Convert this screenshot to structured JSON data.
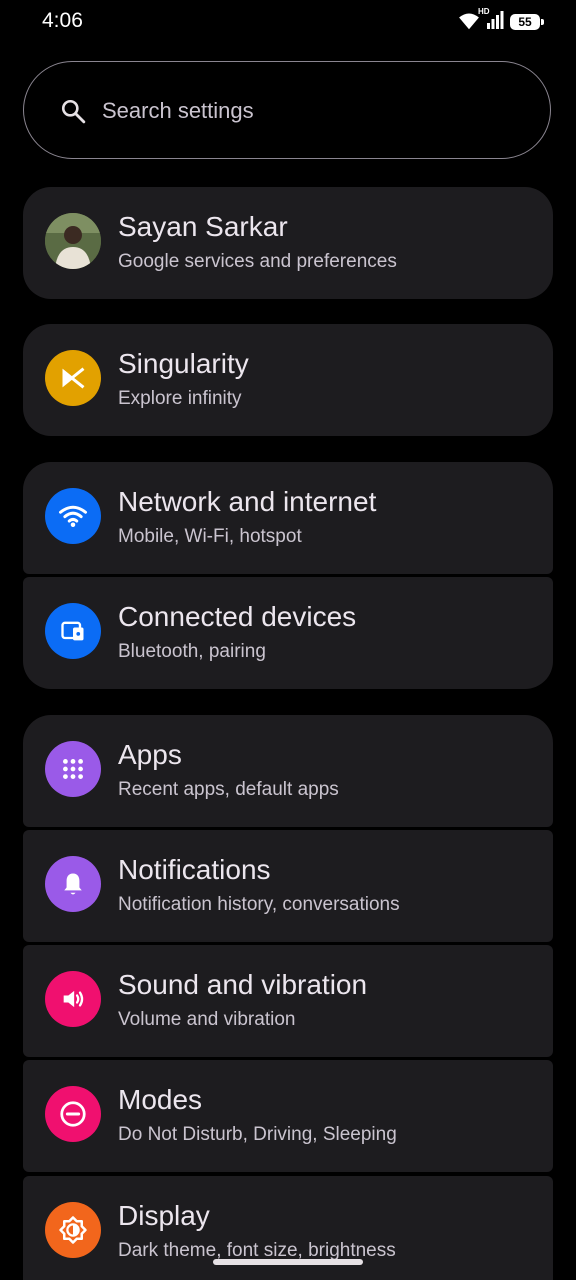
{
  "status_bar": {
    "time": "4:06",
    "network_label": "HD",
    "battery": "55"
  },
  "search": {
    "placeholder": "Search settings"
  },
  "account": {
    "name": "Sayan Sarkar",
    "subtitle": "Google services and preferences"
  },
  "items": [
    {
      "title": "Singularity",
      "subtitle": "Explore infinity",
      "icon": "singularity-icon",
      "color": "#e2a100"
    },
    {
      "title": "Network and internet",
      "subtitle": "Mobile, Wi-Fi, hotspot",
      "icon": "wifi-icon",
      "color": "#0b6cf5"
    },
    {
      "title": "Connected devices",
      "subtitle": "Bluetooth, pairing",
      "icon": "devices-icon",
      "color": "#0b6cf5"
    },
    {
      "title": "Apps",
      "subtitle": "Recent apps, default apps",
      "icon": "apps-grid-icon",
      "color": "#9a5ae8"
    },
    {
      "title": "Notifications",
      "subtitle": "Notification history, conversations",
      "icon": "bell-icon",
      "color": "#9a5ae8"
    },
    {
      "title": "Sound and vibration",
      "subtitle": "Volume and vibration",
      "icon": "speaker-icon",
      "color": "#f0106f"
    },
    {
      "title": "Modes",
      "subtitle": "Do Not Disturb, Driving, Sleeping",
      "icon": "do-not-disturb-icon",
      "color": "#f0106f"
    },
    {
      "title": "Display",
      "subtitle": "Dark theme, font size, brightness",
      "icon": "brightness-icon",
      "color": "#f2661c"
    }
  ]
}
